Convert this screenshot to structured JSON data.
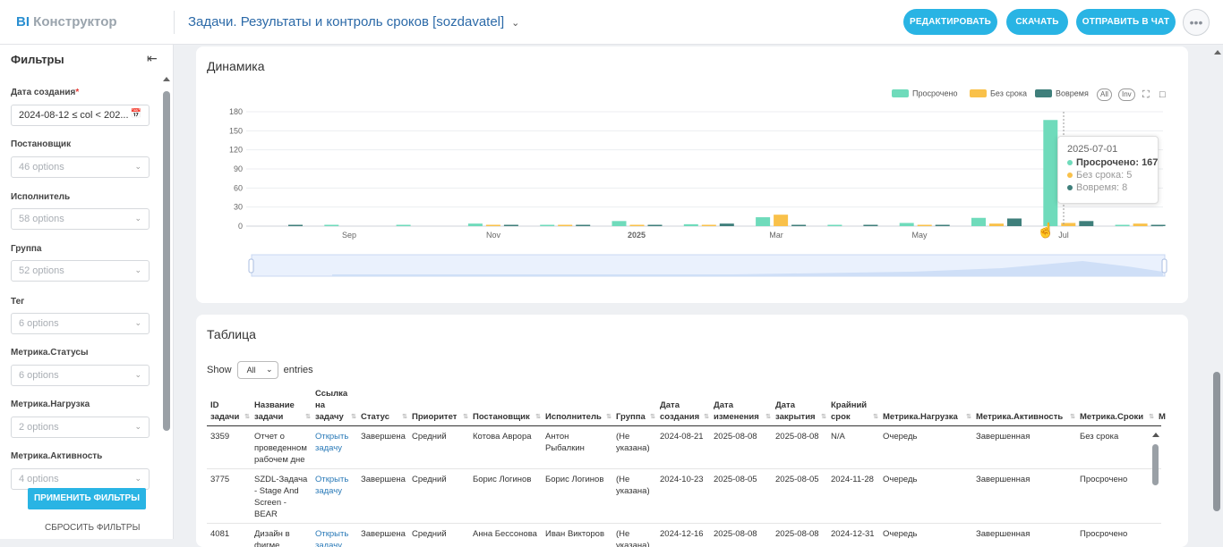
{
  "header": {
    "logo_bi": "BI",
    "logo_rest": "Конструктор",
    "title": "Задачи. Результаты и контроль сроков [sozdavatel]",
    "buttons": {
      "edit": "РЕДАКТИРОВАТЬ",
      "download": "СКАЧАТЬ",
      "send": "ОТПРАВИТЬ В ЧАТ"
    }
  },
  "sidebar": {
    "title": "Фильтры",
    "filters": [
      {
        "label": "Дата создания",
        "value": "2024-08-12 ≤ col < 202...",
        "required": true
      },
      {
        "label": "Постановщик",
        "value": "46 options"
      },
      {
        "label": "Исполнитель",
        "value": "58 options"
      },
      {
        "label": "Группа",
        "value": "52 options"
      },
      {
        "label": "Тег",
        "value": "6 options"
      },
      {
        "label": "Метрика.Статусы",
        "value": "6 options"
      },
      {
        "label": "Метрика.Нагрузка",
        "value": "2 options"
      },
      {
        "label": "Метрика.Активность",
        "value": "4 options"
      }
    ],
    "apply": "ПРИМЕНИТЬ ФИЛЬТРЫ",
    "reset": "СБРОСИТЬ ФИЛЬТРЫ"
  },
  "chart_card": {
    "title": "Динамика",
    "legend_all": "All",
    "legend_inv": "Inv"
  },
  "colors": {
    "overdue": "#6fdbbb",
    "no_deadline": "#f9c14a",
    "on_time": "#3f7f7b",
    "accent": "#29b4e4"
  },
  "chart_data": {
    "type": "bar",
    "ylim": [
      0,
      180
    ],
    "yticks": [
      "180",
      "150",
      "120",
      "90",
      "60",
      "30",
      "0"
    ],
    "xticks": [
      "Sep",
      "Nov",
      "2025",
      "Mar",
      "May",
      "Jul"
    ],
    "categories": [
      "2024-08",
      "2024-09",
      "2024-10",
      "2024-11",
      "2024-12",
      "2025-01",
      "2025-02",
      "2025-03",
      "2025-04",
      "2025-05",
      "2025-06",
      "2025-07",
      "2025-08"
    ],
    "series": [
      {
        "name": "Просрочено",
        "values": [
          0,
          1,
          1,
          4,
          2,
          8,
          3,
          14,
          1,
          5,
          13,
          167,
          2
        ]
      },
      {
        "name": "Без срока",
        "values": [
          0,
          0,
          0,
          2,
          1,
          1,
          1,
          18,
          0,
          1,
          4,
          5,
          4
        ]
      },
      {
        "name": "Вовремя",
        "values": [
          2,
          0,
          0,
          1,
          2,
          2,
          4,
          1,
          1,
          1,
          12,
          8,
          1
        ]
      }
    ],
    "tooltip": {
      "date": "2025-07-01",
      "rows": [
        "Просрочено: 167",
        "Без срока: 5",
        "Вовремя: 8"
      ]
    }
  },
  "table_card": {
    "title": "Таблица",
    "show": "Show",
    "show_value": "All",
    "entries": "entries",
    "columns": [
      "ID задачи",
      "Название задачи",
      "Ссылка на задачу",
      "Статус",
      "Приоритет",
      "Постановщик",
      "Исполнитель",
      "Группа",
      "Дата создания",
      "Дата изменения",
      "Дата закрытия",
      "Крайний срок",
      "Метрика.Нагрузка",
      "Метрика.Активность",
      "Метрика.Сроки",
      "М"
    ],
    "rows": [
      [
        "3359",
        "Отчет о проведенном рабочем дне",
        "Открыть задачу",
        "Завершена",
        "Средний",
        "Котова Аврора",
        "Антон Рыбалкин",
        "(Не указана)",
        "2024-08-21",
        "2025-08-08",
        "2025-08-08",
        "N/A",
        "Очередь",
        "Завершенная",
        "Без срока"
      ],
      [
        "3775",
        "SZDL-Задача - Stage And Screen - BEAR",
        "Открыть задачу",
        "Завершена",
        "Средний",
        "Борис Логинов",
        "Борис Логинов",
        "(Не указана)",
        "2024-10-23",
        "2025-08-05",
        "2025-08-05",
        "2024-11-28",
        "Очередь",
        "Завершенная",
        "Просрочено"
      ],
      [
        "4081",
        "Дизайн в фигме",
        "Открыть задачу",
        "Завершена",
        "Средний",
        "Анна Бессонова",
        "Иван Викторов",
        "(Не указана)",
        "2024-12-16",
        "2025-08-08",
        "2025-08-08",
        "2024-12-31",
        "Очередь",
        "Завершенная",
        "Просрочено"
      ]
    ]
  }
}
